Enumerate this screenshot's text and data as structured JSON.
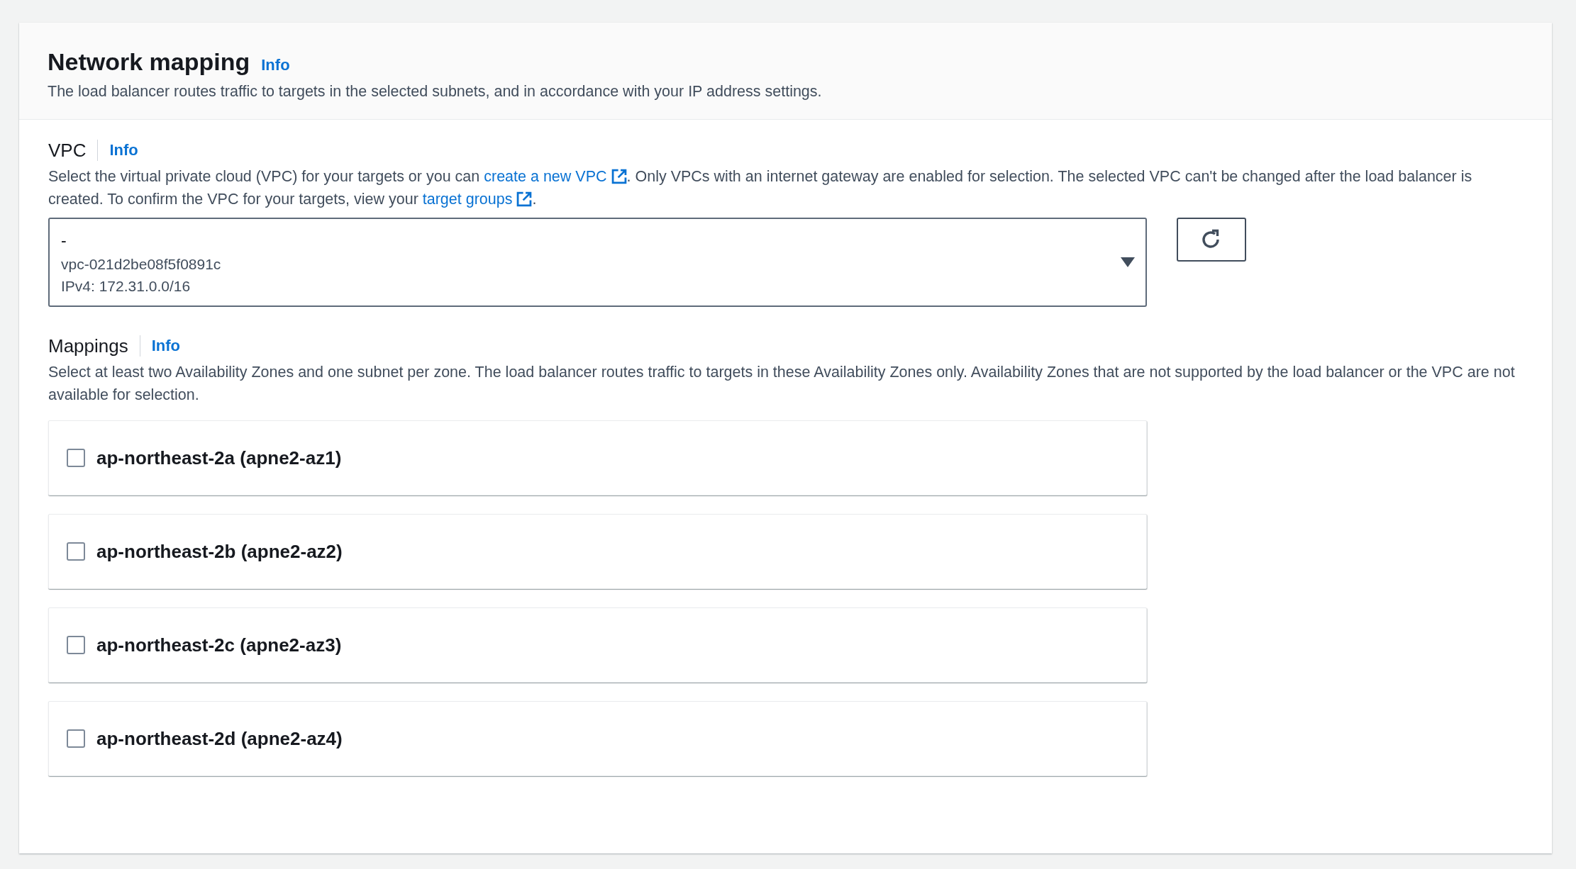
{
  "header": {
    "title": "Network mapping",
    "info": "Info",
    "description": "The load balancer routes traffic to targets in the selected subnets, and in accordance with your IP address settings."
  },
  "vpc": {
    "label": "VPC",
    "info": "Info",
    "description": [
      {
        "kind": "text",
        "text": "Select the virtual private cloud (VPC) for your targets or you can "
      },
      {
        "kind": "link",
        "text": "create a new VPC"
      },
      {
        "kind": "text",
        "text": ". Only VPCs with an internet gateway are enabled for selection. The selected VPC can't be changed after the load balancer is created. To confirm the VPC for your targets, view your "
      },
      {
        "kind": "link",
        "text": "target groups"
      },
      {
        "kind": "text",
        "text": "."
      }
    ],
    "select": {
      "value": "-",
      "id_line": "vpc-021d2be08f5f0891c",
      "cidr_line": "IPv4: 172.31.0.0/16"
    }
  },
  "mappings": {
    "label": "Mappings",
    "info": "Info",
    "description": [
      {
        "kind": "text",
        "text": "Select at least two Availability Zones and one subnet per zone. The load balancer routes traffic to targets in these Availability Zones only. Availability Zones that are not supported by the load balancer or the VPC are not available for selection."
      }
    ],
    "zones": [
      {
        "label": "ap-northeast-2a (apne2-az1)",
        "checked": false
      },
      {
        "label": "ap-northeast-2b (apne2-az2)",
        "checked": false
      },
      {
        "label": "ap-northeast-2c (apne2-az3)",
        "checked": false
      },
      {
        "label": "ap-northeast-2d (apne2-az4)",
        "checked": false
      }
    ]
  }
}
